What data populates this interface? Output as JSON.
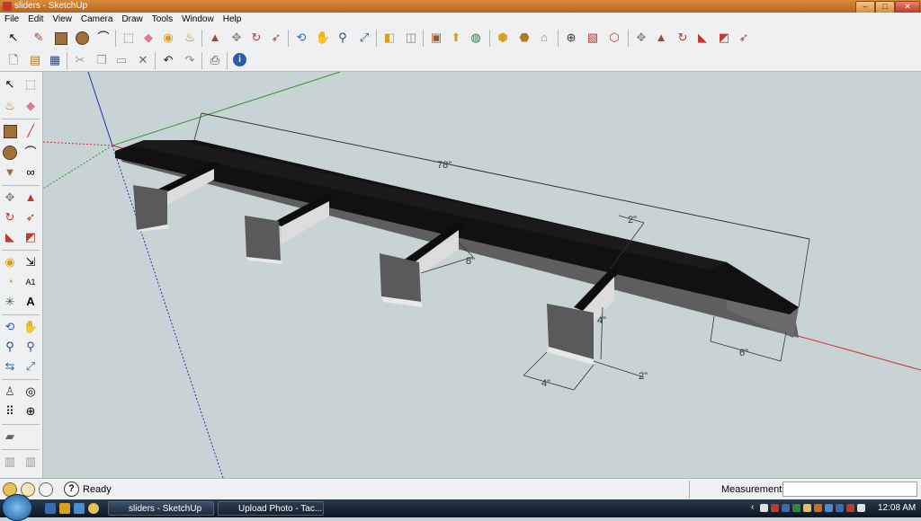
{
  "window": {
    "title": "sliders - SketchUp",
    "minimize": "–",
    "maximize": "□",
    "close": "✕"
  },
  "menu": [
    "File",
    "Edit",
    "View",
    "Camera",
    "Draw",
    "Tools",
    "Window",
    "Help"
  ],
  "model": {
    "dimensions": {
      "length": "78\"",
      "top_width": "2\"",
      "cross_gap": "8\"",
      "end_width": "6\"",
      "foot_width": "4\"",
      "foot_height": "4\"",
      "foot_depth": "2\""
    }
  },
  "status": {
    "message": "Ready",
    "measurements_label": "Measurements",
    "measurements_value": ""
  },
  "taskbar": {
    "tasks": [
      "sliders - SketchUp",
      "Upload Photo - Tac..."
    ],
    "clock": "12:08 AM"
  },
  "colors": {
    "accent_titlebar": "#c56f25",
    "viewport_bg": "#c8d3d6",
    "axis_red": "#cc3333",
    "axis_green": "#2e9a2e",
    "axis_blue": "#2233aa"
  }
}
